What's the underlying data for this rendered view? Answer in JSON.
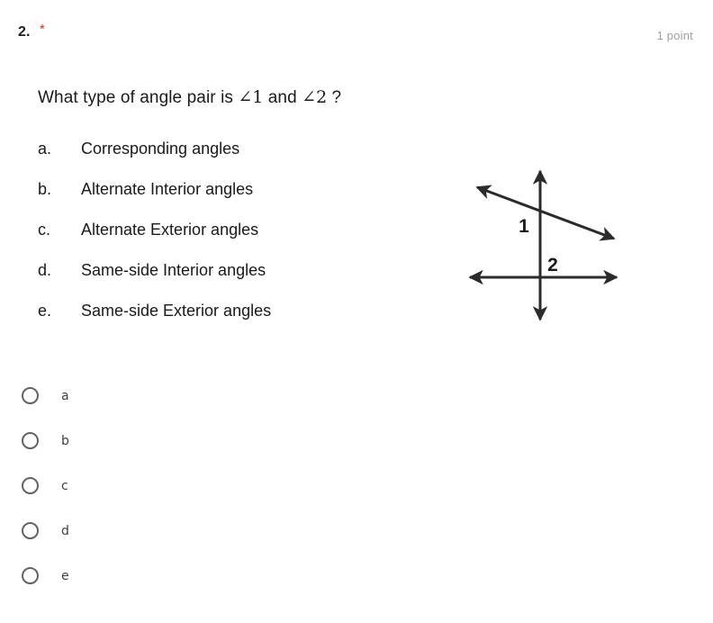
{
  "header": {
    "question_number": "2.",
    "required_marker": "*",
    "points": "1 point",
    "required_color": "#d93025",
    "points_color": "#9aa0a6"
  },
  "question": {
    "text_before": "What type of angle pair is ",
    "angle_one": "∠1",
    "text_middle": " and ",
    "angle_two": "∠2",
    "text_after": " ?",
    "full_text": "What type of angle pair is ∠1 and ∠2 ?"
  },
  "choices": [
    {
      "letter": "a.",
      "text": "Corresponding angles"
    },
    {
      "letter": "b.",
      "text": "Alternate Interior angles"
    },
    {
      "letter": "c.",
      "text": "Alternate Exterior angles"
    },
    {
      "letter": "d.",
      "text": "Same-side Interior angles"
    },
    {
      "letter": "e.",
      "text": "Same-side Exterior angles"
    }
  ],
  "diagram": {
    "label_one": "1",
    "label_two": "2",
    "stroke_color": "#2b2b2b",
    "description": "vertical transversal crossed by a slanted line and a horizontal line"
  },
  "options": [
    {
      "label": "a",
      "selected": false
    },
    {
      "label": "b",
      "selected": false
    },
    {
      "label": "c",
      "selected": false
    },
    {
      "label": "d",
      "selected": false
    },
    {
      "label": "e",
      "selected": false
    }
  ]
}
